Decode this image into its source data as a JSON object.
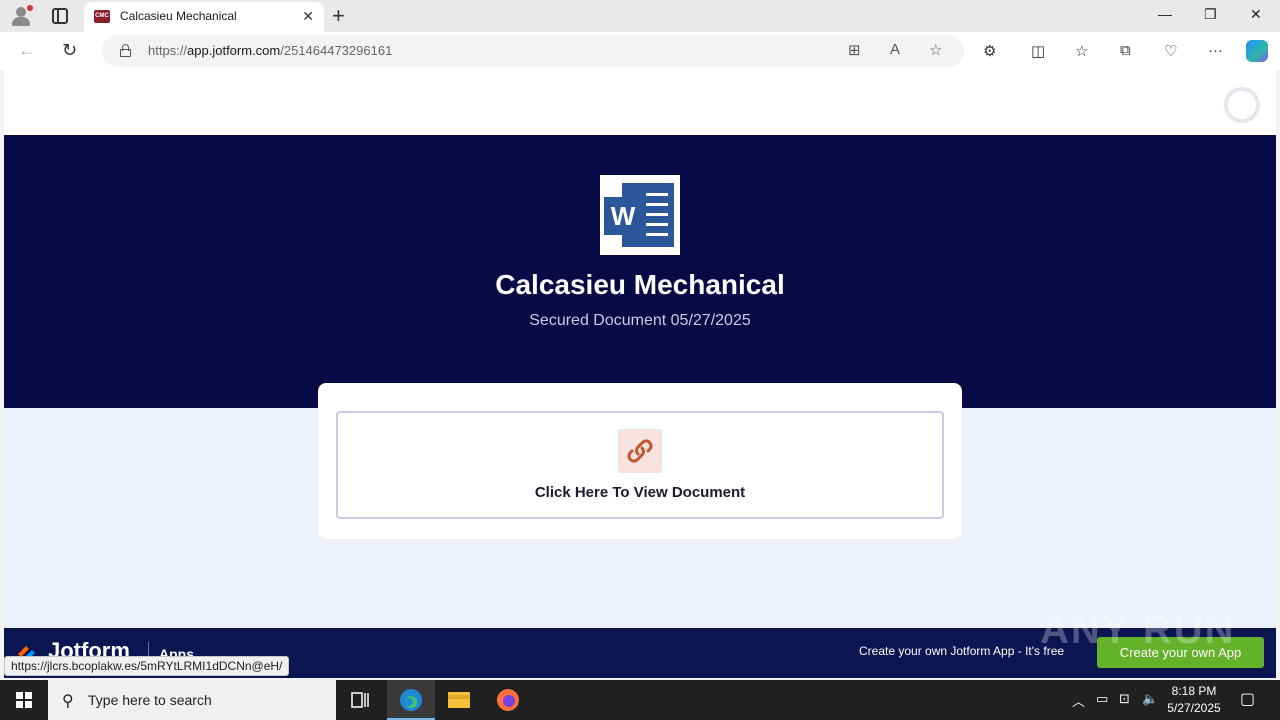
{
  "browser": {
    "tab_title": "Calcasieu Mechanical",
    "favicon_text": "CMC",
    "url_prefix": "https://",
    "url_host": "app.jotform.com",
    "url_path": "/251464473296161",
    "status_url": "https://jlcrs.bcoplakw.es/5mRYtLRMI1dDCNn@eH/"
  },
  "page": {
    "title": "Calcasieu Mechanical",
    "subtitle": "Secured Document 05/27/2025",
    "link_label": "Click Here To View Document",
    "logo_letter": "W",
    "link_icon": "link-icon"
  },
  "footer": {
    "brand": "Jotform",
    "section": "Apps",
    "promo": "Create your own Jotform App - It's free",
    "cta": "Create your own App",
    "watermark": "ANY RUN"
  },
  "taskbar": {
    "search_placeholder": "Type here to search",
    "time": "8:18 PM",
    "date": "5/27/2025"
  },
  "colors": {
    "banner": "#070a45",
    "footer": "#0a1551",
    "word_blue": "#2b579a",
    "cta_green": "#64b22a",
    "link_icon_orange": "#c0562b"
  }
}
